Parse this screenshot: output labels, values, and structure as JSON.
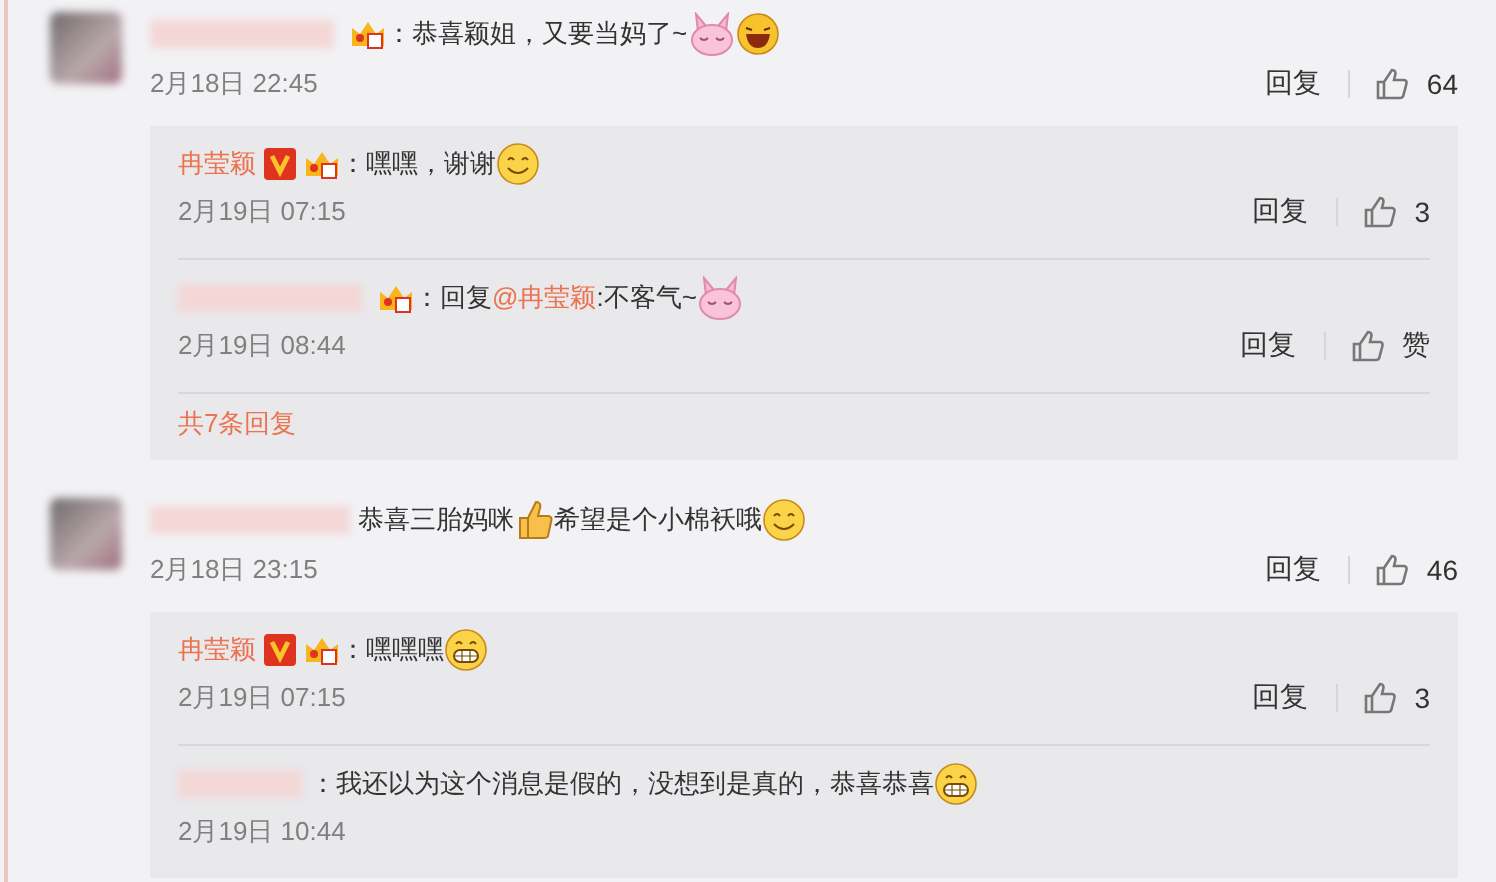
{
  "comments": [
    {
      "author": {
        "blurred": true
      },
      "badge": true,
      "parts": [
        {
          "kind": "text",
          "text": "：恭喜颖姐，又要当妈了~"
        },
        {
          "kind": "bunny"
        },
        {
          "kind": "laugh"
        }
      ],
      "time": "2月18日 22:45",
      "reply_label": "回复",
      "likes": "64",
      "replies": [
        {
          "author": {
            "blurred": false,
            "name": "冉莹颖",
            "verified": true
          },
          "badge": true,
          "parts": [
            {
              "kind": "text",
              "text": "：嘿嘿，谢谢"
            },
            {
              "kind": "smile"
            }
          ],
          "time": "2月19日 07:15",
          "reply_label": "回复",
          "likes": "3"
        },
        {
          "author": {
            "blurred": true
          },
          "badge": true,
          "parts": [
            {
              "kind": "text",
              "text": "：回复"
            },
            {
              "kind": "mention",
              "text": "@冉莹颖"
            },
            {
              "kind": "text",
              "text": ":不客气~"
            },
            {
              "kind": "bunny"
            }
          ],
          "time": "2月19日 08:44",
          "reply_label": "回复",
          "likes": "赞"
        }
      ],
      "more_link": "共7条回复"
    },
    {
      "author": {
        "blurred": true
      },
      "badge": false,
      "parts": [
        {
          "kind": "text",
          "text": "恭喜三胎妈咪"
        },
        {
          "kind": "thumb"
        },
        {
          "kind": "text",
          "text": "希望是个小棉袄哦"
        },
        {
          "kind": "smile"
        }
      ],
      "time": "2月18日 23:15",
      "reply_label": "回复",
      "likes": "46",
      "replies": [
        {
          "author": {
            "blurred": false,
            "name": "冉莹颖",
            "verified": true
          },
          "badge": true,
          "parts": [
            {
              "kind": "text",
              "text": "：嘿嘿嘿"
            },
            {
              "kind": "grin"
            }
          ],
          "time": "2月19日 07:15",
          "reply_label": "回复",
          "likes": "3"
        },
        {
          "author": {
            "blurred": true
          },
          "badge": false,
          "parts": [
            {
              "kind": "text",
              "text": "：我还以为这个消息是假的，没想到是真的，恭喜恭喜"
            },
            {
              "kind": "grin"
            }
          ],
          "time": "2月19日 10:44"
        }
      ]
    }
  ]
}
